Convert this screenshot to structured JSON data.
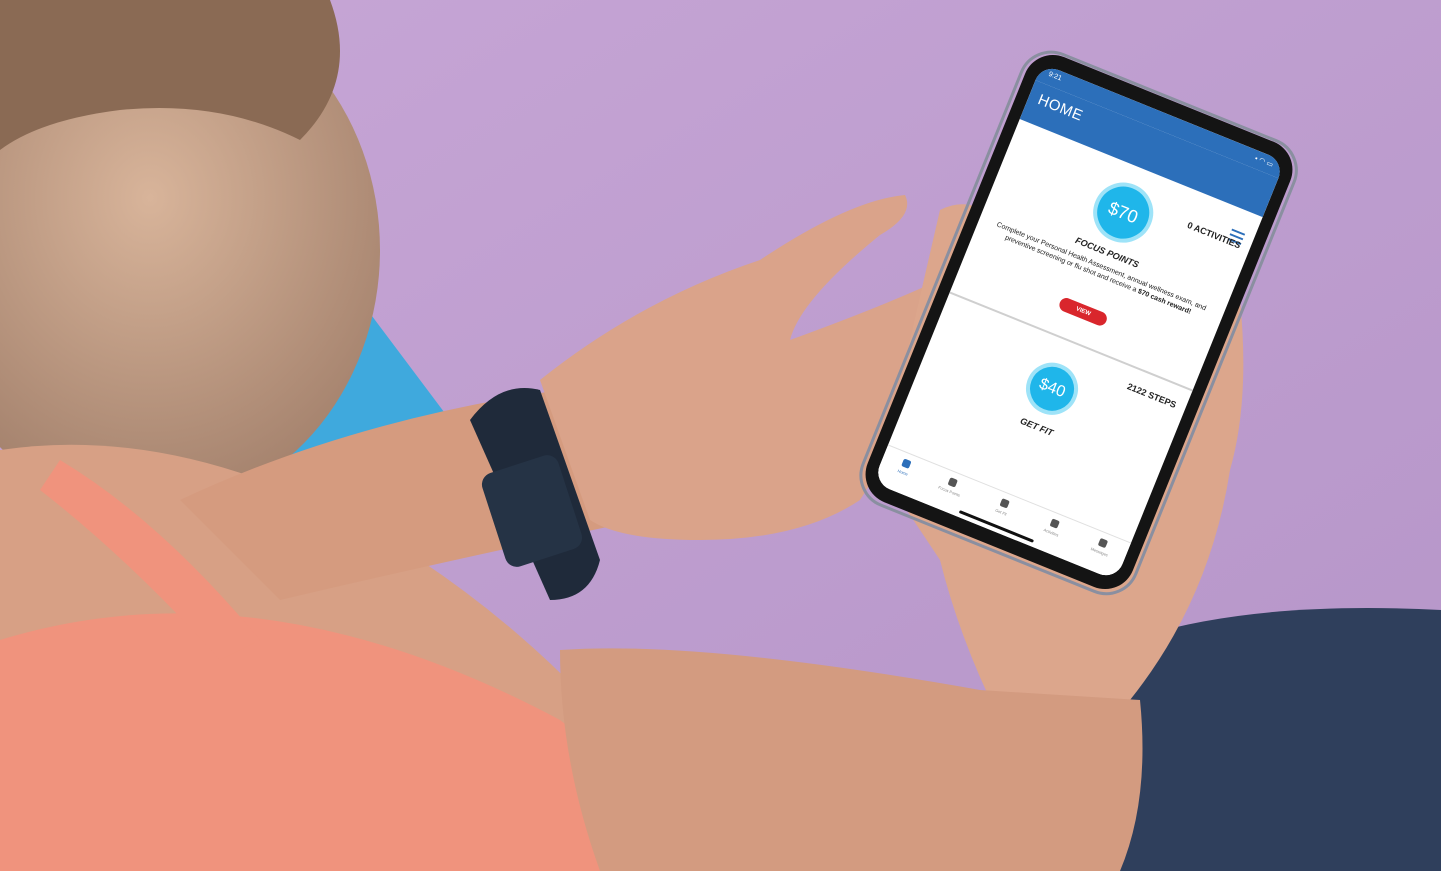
{
  "scene": {
    "description_colors": {
      "background_wall": "#c9a9d8",
      "skin": "#d9a088",
      "shirt": "#f0937d",
      "jeans": "#2f3f5c",
      "shoe": "#3fa9dd",
      "watch": "#1f2a3a",
      "phone_body": "#141414"
    }
  },
  "app": {
    "status_time": "9:21",
    "status_icons": "▪︎ ◠ ▭",
    "header_title": "HOME",
    "menu_icon": "hamburger-icon",
    "cards": [
      {
        "count_label": "0 ACTIVITIES",
        "reward_amount": "$70",
        "title": "FOCUS POINTS",
        "description_prefix": "Complete your Personal Health Assessment, annual wellness exam, and preventive screening or flu shot and receive a ",
        "description_bold": "$70 cash reward!",
        "button_label": "VIEW"
      },
      {
        "count_label": "2122 STEPS",
        "reward_amount": "$40",
        "title": "GET FIT"
      }
    ],
    "tabs": [
      {
        "label": "Home",
        "icon": "home-icon"
      },
      {
        "label": "Focus Points",
        "icon": "trophy-icon"
      },
      {
        "label": "Get Fit",
        "icon": "running-icon"
      },
      {
        "label": "Activities",
        "icon": "pencil-icon"
      },
      {
        "label": "Messages",
        "icon": "envelope-icon"
      }
    ],
    "accent_color": "#2c6fba",
    "reward_color": "#1fb6ea",
    "button_color": "#d9262c"
  }
}
